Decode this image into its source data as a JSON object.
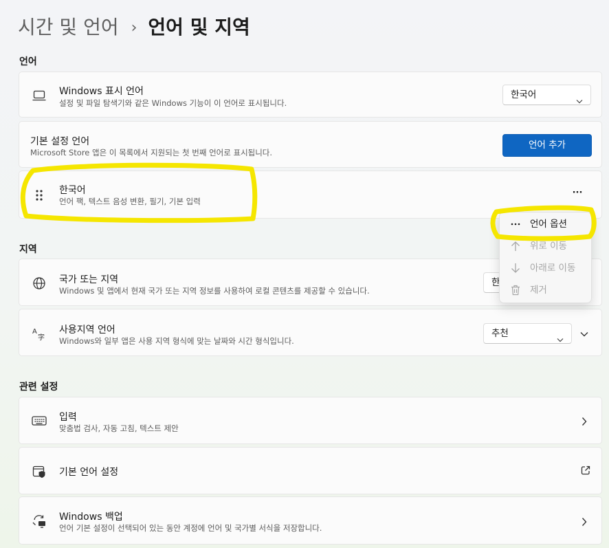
{
  "breadcrumb": {
    "parent": "시간 및 언어",
    "separator": "›",
    "current": "언어 및 지역"
  },
  "sections": {
    "language": "언어",
    "region": "지역",
    "related": "관련 설정"
  },
  "display_language": {
    "title": "Windows 표시 언어",
    "subtitle": "설정 및 파일 탐색기와 같은 Windows 기능이 이 언어로 표시됩니다.",
    "value": "한국어",
    "icon": "monitor-icon"
  },
  "preferred_language": {
    "title": "기본 설정 언어",
    "subtitle": "Microsoft Store 앱은 이 목록에서 지원되는 첫 번째 언어로 표시됩니다.",
    "button": "언어 추가"
  },
  "korean_item": {
    "title": "한국어",
    "subtitle": "언어 팩, 텍스트 음성 변환, 필기, 기본 입력",
    "more": "···",
    "icon": "drag-handle-icon"
  },
  "context_menu": {
    "items": [
      {
        "label": "언어 옵션",
        "icon": "more-icon",
        "enabled": true
      },
      {
        "label": "위로 이동",
        "icon": "arrow-up-icon",
        "enabled": false
      },
      {
        "label": "아래로 이동",
        "icon": "arrow-down-icon",
        "enabled": false
      },
      {
        "label": "제거",
        "icon": "trash-icon",
        "enabled": false
      }
    ]
  },
  "country_region": {
    "title": "국가 또는 지역",
    "subtitle": "Windows 및 앱에서 현재 국가 또는 지역 정보를 사용하여 로컬 콘텐츠를 제공할 수 있습니다.",
    "value_partial": "한",
    "icon": "globe-icon"
  },
  "regional_format": {
    "title": "사용지역 언어",
    "subtitle": "Windows와 일부 앱은 사용 지역 형식에 맞는 날짜와 시간 형식입니다.",
    "value": "추천",
    "icon": "language-format-icon"
  },
  "typing": {
    "title": "입력",
    "subtitle": "맞춤법 검사, 자동 고침, 텍스트 제안",
    "icon": "keyboard-icon"
  },
  "admin_language": {
    "title": "기본 언어 설정",
    "icon": "window-shield-icon"
  },
  "windows_backup": {
    "title": "Windows 백업",
    "subtitle": "언어 기본 설정이 선택되어 있는 동안 계정에 언어 및 국가별 서식을 저장합니다.",
    "icon": "backup-sync-icon"
  },
  "colors": {
    "accent": "#0f66c2",
    "highlight": "#f5e600"
  }
}
